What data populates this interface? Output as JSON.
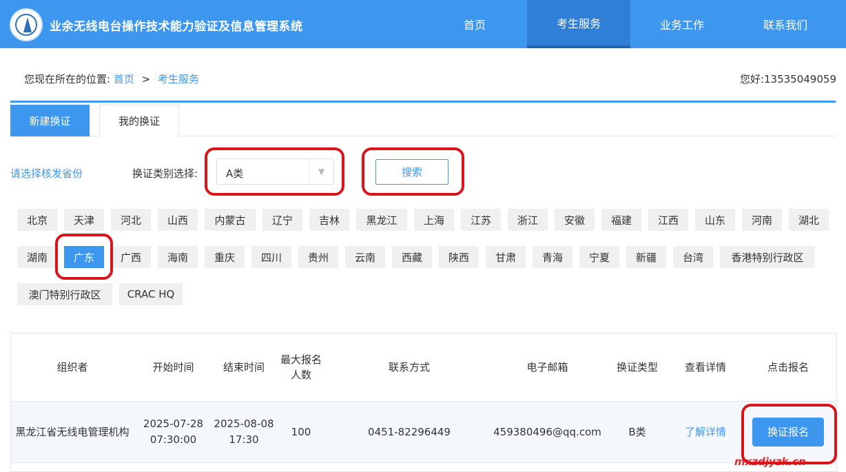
{
  "header": {
    "site_title": "业余无线电台操作技术能力验证及信息管理系统",
    "nav": [
      "首页",
      "考生服务",
      "业务工作",
      "联系我们"
    ],
    "active_nav": 1
  },
  "breadcrumb": {
    "prefix": "您现在所在的位置:",
    "items": [
      "首页",
      "考生服务"
    ],
    "separator": ">"
  },
  "user": {
    "greeting": "您好:13535049059"
  },
  "tabs": [
    "新建换证",
    "我的换证"
  ],
  "filters": {
    "province_hint": "请选择核发省份",
    "type_label": "换证类别选择:",
    "type_value": "A类",
    "search_label": "搜索"
  },
  "provinces": [
    "北京",
    "天津",
    "河北",
    "山西",
    "内蒙古",
    "辽宁",
    "吉林",
    "黑龙江",
    "上海",
    "江苏",
    "浙江",
    "安徽",
    "福建",
    "江西",
    "山东",
    "河南",
    "湖北",
    "湖南",
    "广东",
    "广西",
    "海南",
    "重庆",
    "四川",
    "贵州",
    "云南",
    "西藏",
    "陕西",
    "甘肃",
    "青海",
    "宁夏",
    "新疆",
    "台湾",
    "香港特别行政区",
    "澳门特别行政区",
    "CRAC HQ"
  ],
  "selected_province": "广东",
  "table": {
    "headers": [
      "组织者",
      "开始时间",
      "结束时间",
      "最大报名人数",
      "联系方式",
      "电子邮箱",
      "换证类型",
      "查看详情",
      "点击报名"
    ],
    "header_lines": {
      "3": [
        "最大报名",
        "人数"
      ]
    },
    "rows": [
      {
        "organizer": "黑龙江省无线电管理机构",
        "start_date": "2025-07-28",
        "start_time": "07:30:00",
        "end_date": "2025-08-08",
        "end_time": "17:30",
        "max_count": "100",
        "contact": "0451-82296449",
        "email": "459380496@qq.com",
        "type": "B类",
        "details": "了解详情",
        "enroll": "换证报名"
      }
    ]
  },
  "watermark": "mxzdjyzk.cn",
  "colors": {
    "primary": "#3d97ee",
    "highlight": "#d9141b",
    "chip_bg": "#f0f0f0"
  },
  "icons": {
    "select_arrow": "chevron-down-icon",
    "logo": "emblem-logo-icon"
  }
}
